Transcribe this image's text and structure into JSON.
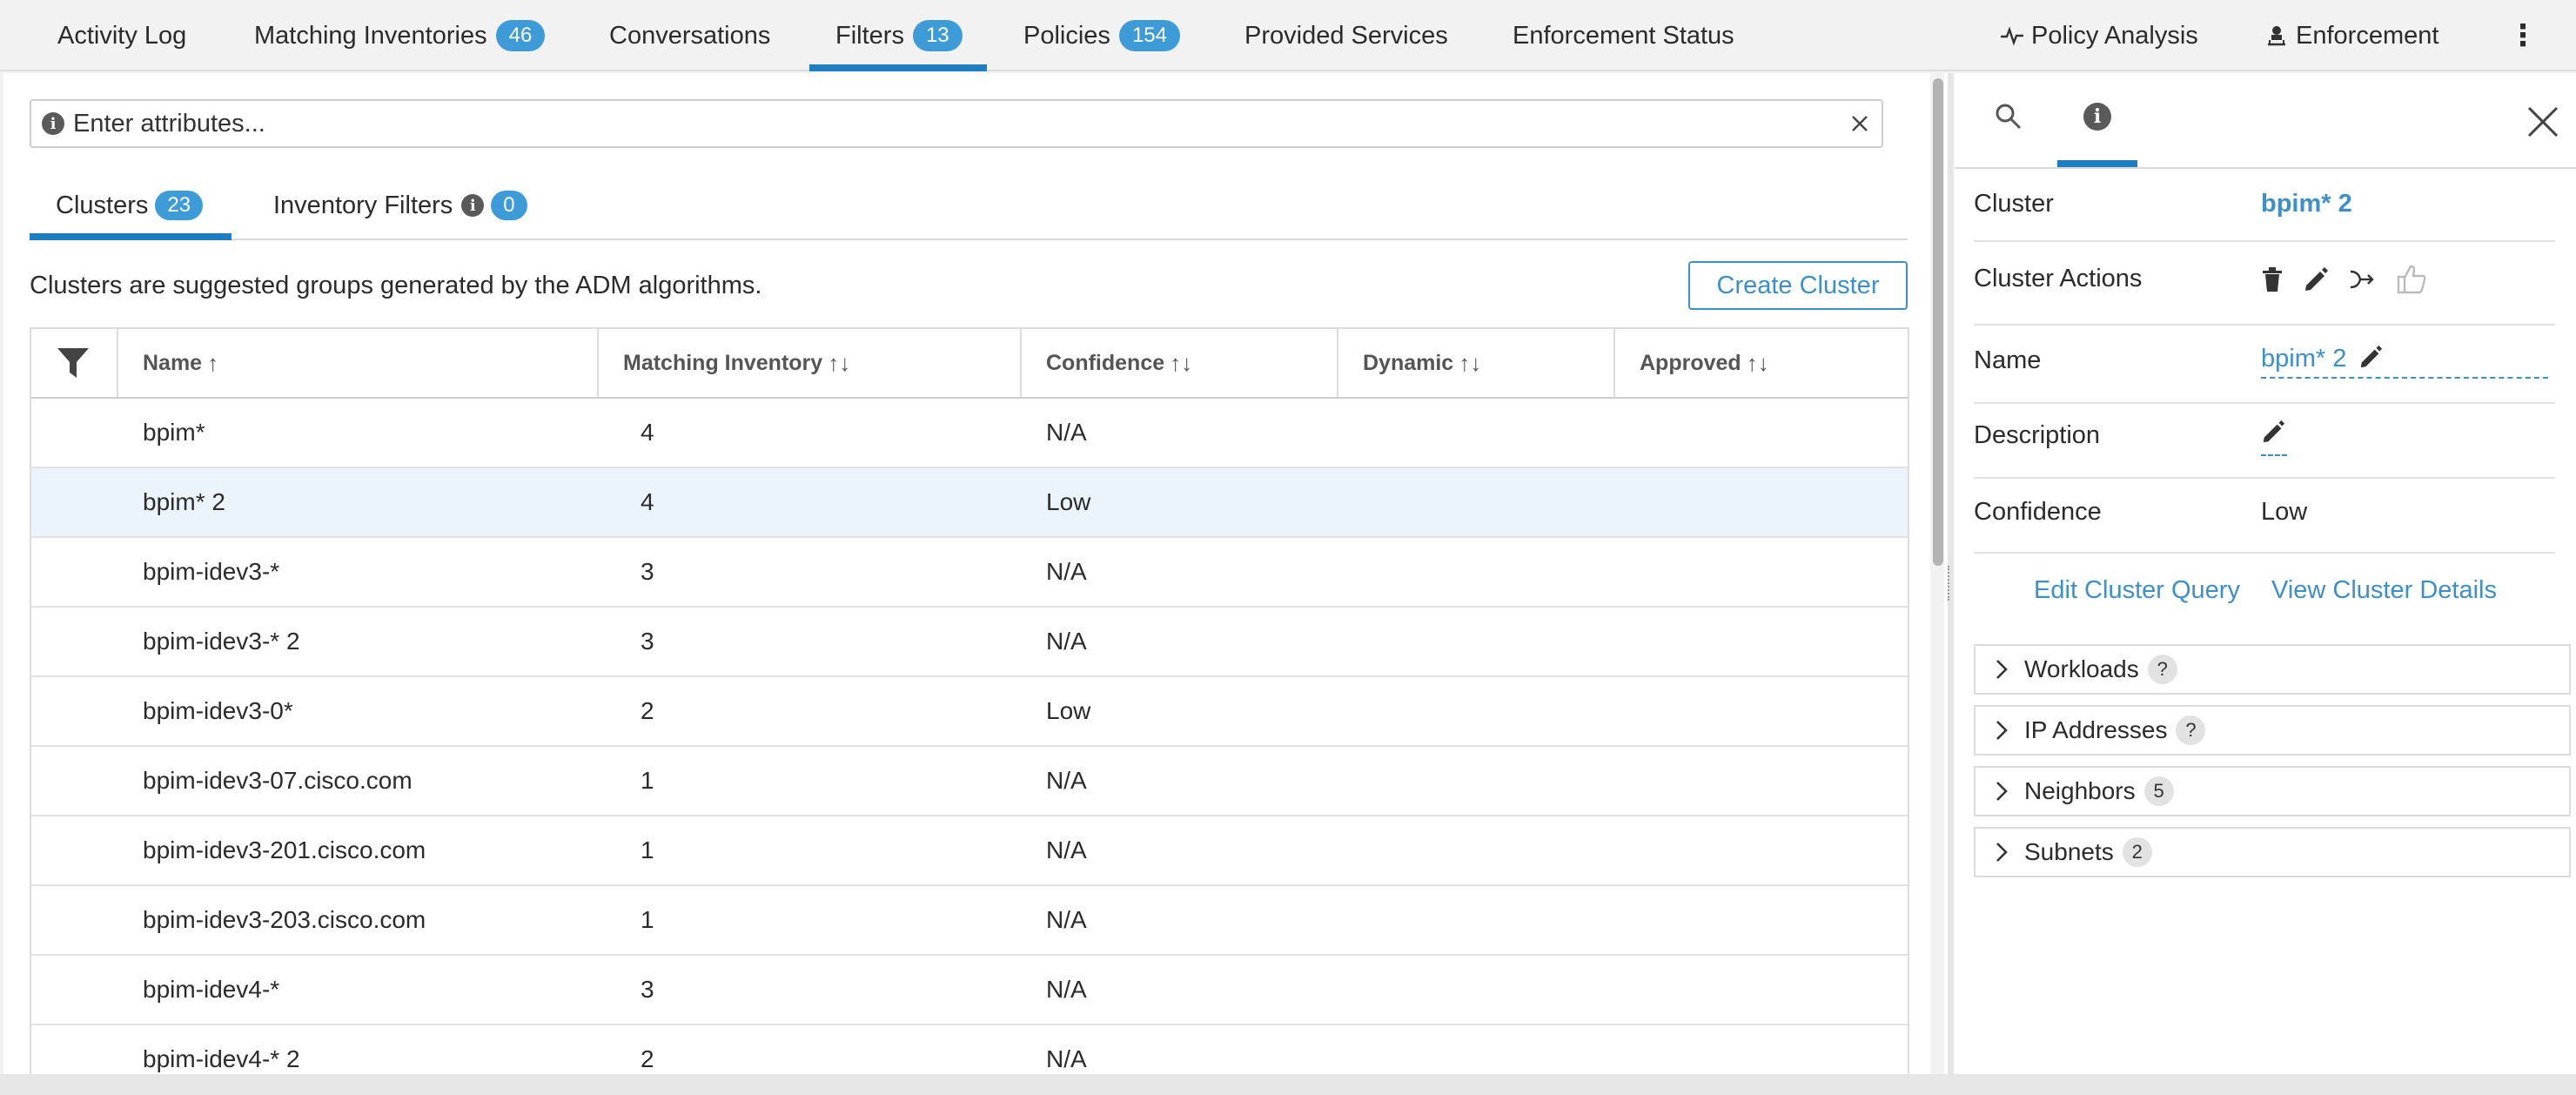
{
  "nav": {
    "tabs": [
      {
        "label": "Activity Log",
        "count": ""
      },
      {
        "label": "Matching Inventories",
        "count": "46"
      },
      {
        "label": "Conversations",
        "count": ""
      },
      {
        "label": "Filters",
        "count": "13"
      },
      {
        "label": "Policies",
        "count": "154"
      },
      {
        "label": "Provided Services",
        "count": ""
      },
      {
        "label": "Enforcement Status",
        "count": ""
      }
    ],
    "active_tab": "Filters",
    "policy_analysis": "Policy Analysis",
    "enforcement": "Enforcement",
    "more": "⋮"
  },
  "search": {
    "placeholder": "Enter attributes...",
    "value": ""
  },
  "subtabs": {
    "clusters_label": "Clusters",
    "clusters_count": "23",
    "inventory_filters_label": "Inventory Filters",
    "inventory_filters_count": "0"
  },
  "description": "Clusters are suggested groups generated by the ADM algorithms.",
  "create_cluster": "Create Cluster",
  "table": {
    "headers": {
      "name": "Name",
      "matching_inventory": "Matching Inventory",
      "confidence": "Confidence",
      "dynamic": "Dynamic",
      "approved": "Approved"
    },
    "sort_asc": "↑",
    "sort_both": "↑↓",
    "rows": [
      {
        "name": "bpim*",
        "matching_inventory": "4",
        "confidence": "N/A",
        "dynamic": "",
        "approved": ""
      },
      {
        "name": "bpim* 2",
        "matching_inventory": "4",
        "confidence": "Low",
        "dynamic": "",
        "approved": ""
      },
      {
        "name": "bpim-idev3-*",
        "matching_inventory": "3",
        "confidence": "N/A",
        "dynamic": "",
        "approved": ""
      },
      {
        "name": "bpim-idev3-* 2",
        "matching_inventory": "3",
        "confidence": "N/A",
        "dynamic": "",
        "approved": ""
      },
      {
        "name": "bpim-idev3-0*",
        "matching_inventory": "2",
        "confidence": "Low",
        "dynamic": "",
        "approved": ""
      },
      {
        "name": "bpim-idev3-07.cisco.com",
        "matching_inventory": "1",
        "confidence": "N/A",
        "dynamic": "",
        "approved": ""
      },
      {
        "name": "bpim-idev3-201.cisco.com",
        "matching_inventory": "1",
        "confidence": "N/A",
        "dynamic": "",
        "approved": ""
      },
      {
        "name": "bpim-idev3-203.cisco.com",
        "matching_inventory": "1",
        "confidence": "N/A",
        "dynamic": "",
        "approved": ""
      },
      {
        "name": "bpim-idev4-*",
        "matching_inventory": "3",
        "confidence": "N/A",
        "dynamic": "",
        "approved": ""
      },
      {
        "name": "bpim-idev4-* 2",
        "matching_inventory": "2",
        "confidence": "N/A",
        "dynamic": "",
        "approved": ""
      }
    ],
    "selected_row": 1
  },
  "details": {
    "cluster_label": "Cluster",
    "cluster_value": "bpim* 2",
    "actions_label": "Cluster Actions",
    "name_label": "Name",
    "name_value": "bpim* 2",
    "description_label": "Description",
    "confidence_label": "Confidence",
    "confidence_value": "Low",
    "edit_query": "Edit Cluster Query",
    "view_details": "View Cluster Details",
    "sections": [
      {
        "label": "Workloads",
        "count": "?"
      },
      {
        "label": "IP Addresses",
        "count": "?"
      },
      {
        "label": "Neighbors",
        "count": "5"
      },
      {
        "label": "Subnets",
        "count": "2"
      }
    ]
  },
  "colors": {
    "accent": "#1e7ebf",
    "badge": "#3d9bd7",
    "link": "#3d8fc9",
    "selected_row": "#eaf4fa"
  }
}
